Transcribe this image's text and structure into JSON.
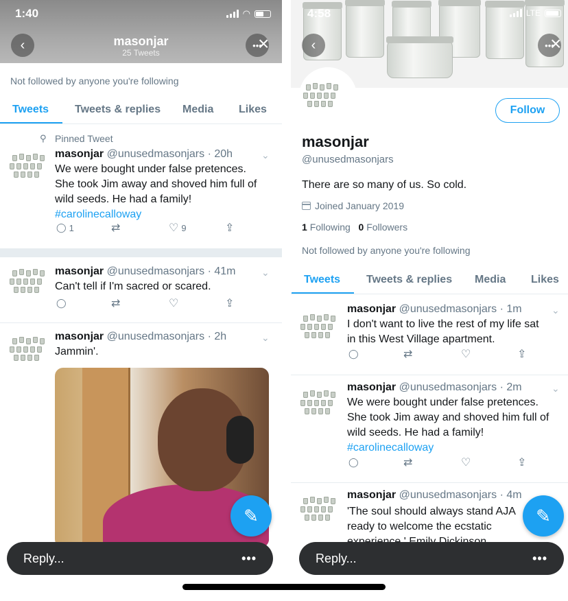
{
  "left": {
    "status": {
      "time": "1:40"
    },
    "header": {
      "title": "masonjar",
      "subtitle": "25 Tweets"
    },
    "not_followed": "Not followed by anyone you're following",
    "tabs": [
      "Tweets",
      "Tweets & replies",
      "Media",
      "Likes"
    ],
    "pinned_label": "Pinned Tweet",
    "tweets": [
      {
        "name": "masonjar",
        "meta": "@unusedmasonjars · 20h",
        "lines": [
          "We were bought under false pretences.",
          "She took Jim away and shoved him full of",
          "wild seeds. He had a family!"
        ],
        "hashtag": "#carolinecalloway",
        "replies": "1",
        "likes": "9"
      },
      {
        "name": "masonjar",
        "meta": "@unusedmasonjars · 41m",
        "lines": [
          "Can't tell if I'm sacred or scared."
        ]
      },
      {
        "name": "masonjar",
        "meta": "@unusedmasonjars · 2h",
        "lines": [
          "Jammin'."
        ]
      }
    ],
    "reply_placeholder": "Reply...",
    "reply_more": "•••"
  },
  "right": {
    "status": {
      "time": "4:58",
      "network": "LTE"
    },
    "profile": {
      "follow_label": "Follow",
      "name": "masonjar",
      "handle": "@unusedmasonjars",
      "bio": "There are so many of us. So cold.",
      "joined": "Joined January 2019",
      "following_count": "1",
      "following_label": "Following",
      "followers_count": "0",
      "followers_label": "Followers"
    },
    "not_followed": "Not followed by anyone you're following",
    "tabs": [
      "Tweets",
      "Tweets & replies",
      "Media",
      "Likes"
    ],
    "tweets": [
      {
        "name": "masonjar",
        "meta": "@unusedmasonjars · 1m",
        "lines": [
          "I don't want to live the rest of my life sat",
          "in this West Village apartment."
        ]
      },
      {
        "name": "masonjar",
        "meta": "@unusedmasonjars · 2m",
        "lines": [
          "We were bought under false pretences.",
          "She took Jim away and shoved him full of",
          "wild seeds. He had a family!"
        ],
        "hashtag": "#carolinecalloway"
      },
      {
        "name": "masonjar",
        "meta": "@unusedmasonjars · 4m",
        "lines": [
          "'The soul should always stand AJA",
          "ready to welcome the ecstatic",
          "experience.' Emily Dickinson"
        ]
      }
    ],
    "reply_placeholder": "Reply...",
    "reply_more": "•••"
  },
  "colors": {
    "accent": "#1da1f2",
    "text": "#14171a",
    "muted": "#657786",
    "divider": "#e6ecf0"
  }
}
